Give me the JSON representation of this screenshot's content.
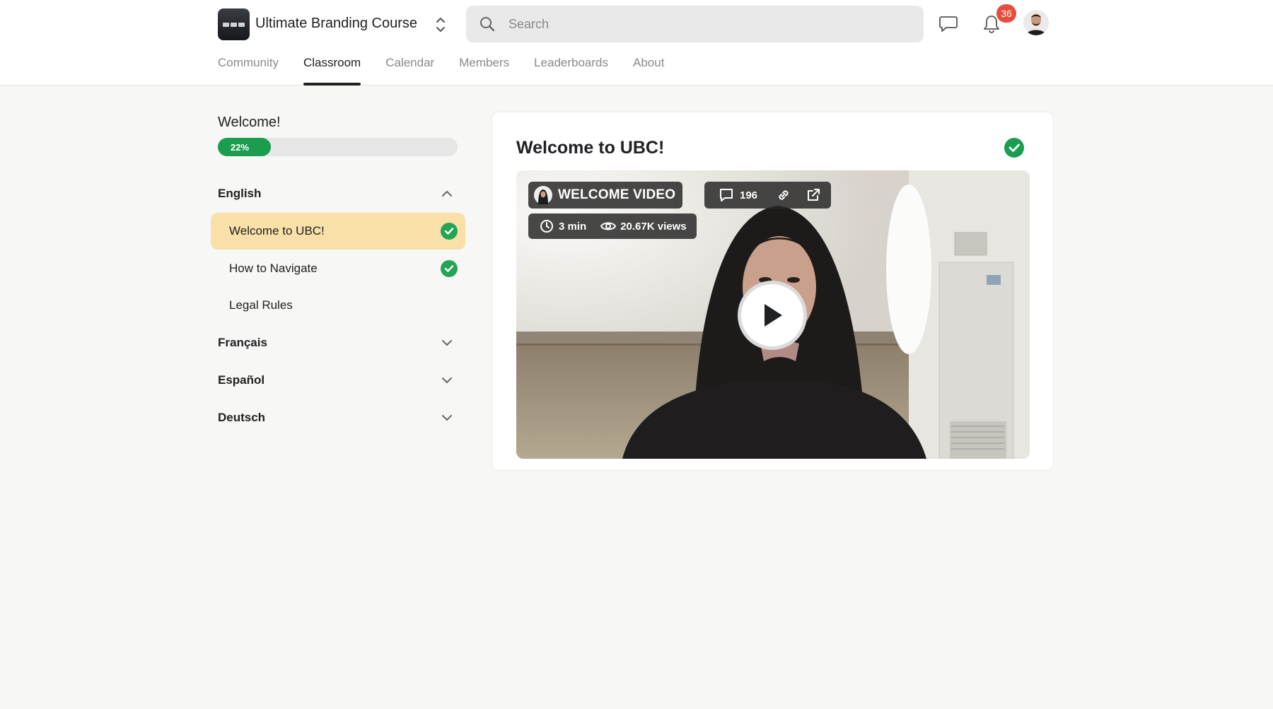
{
  "header": {
    "brand": "Ultimate Branding Course",
    "search_placeholder": "Search",
    "notification_count": "36",
    "icons": [
      "group-logo-icon",
      "switch-group-icon",
      "search-icon",
      "chat-icon",
      "bell-icon",
      "avatar"
    ]
  },
  "tabs": [
    {
      "label": "Community",
      "active": false
    },
    {
      "label": "Classroom",
      "active": true
    },
    {
      "label": "Calendar",
      "active": false
    },
    {
      "label": "Members",
      "active": false
    },
    {
      "label": "Leaderboards",
      "active": false
    },
    {
      "label": "About",
      "active": false
    }
  ],
  "course": {
    "title": "Welcome!",
    "progress_label": "22%",
    "progress": 0.22
  },
  "sections": [
    {
      "label": "English",
      "expanded": true
    },
    {
      "label": "Français",
      "expanded": false
    },
    {
      "label": "Español",
      "expanded": false
    },
    {
      "label": "Deutsch",
      "expanded": false
    }
  ],
  "lessons": [
    {
      "label": "Welcome to UBC!",
      "completed": true,
      "active": true
    },
    {
      "label": "How to Navigate",
      "completed": true,
      "active": false
    },
    {
      "label": "Legal Rules",
      "completed": false,
      "active": false
    }
  ],
  "content": {
    "title": "Welcome to UBC!",
    "completed": true,
    "video": {
      "label": "WELCOME VIDEO",
      "comments": "196",
      "duration": "3 min",
      "views": "20.67K views"
    }
  },
  "colors": {
    "accent_green": "#1a9d4f",
    "active_lesson_bg": "#f8e0a8",
    "badge_red": "#e74c3c"
  }
}
